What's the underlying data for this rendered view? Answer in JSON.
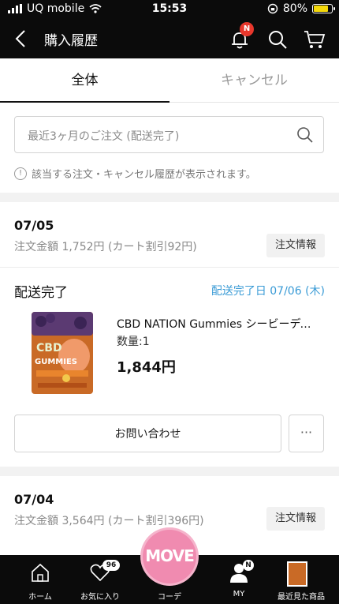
{
  "status_bar": {
    "carrier": "UQ mobile",
    "time": "15:53",
    "battery": "80%",
    "battery_level": 0.8
  },
  "header": {
    "title": "購入履歴",
    "notification_badge": "N"
  },
  "tabs": [
    {
      "label": "全体",
      "active": true
    },
    {
      "label": "キャンセル",
      "active": false
    }
  ],
  "search": {
    "placeholder": "最近3ヶ月のご注文 (配送完了)"
  },
  "notice": "該当する注文・キャンセル履歴が表示されます。",
  "orders": [
    {
      "date": "07/05",
      "amount": "注文金額 1,752円 (カート割引92円)",
      "order_info_label": "注文情報",
      "status": "配送完了",
      "delivery_date": "配送完了日 07/06 (木)",
      "product": {
        "name": "CBD NATION Gummies シービーディーネイション グミ",
        "quantity": "数量:1",
        "price": "1,844円"
      },
      "contact_label": "お問い合わせ",
      "more_label": "···"
    },
    {
      "date": "07/04",
      "amount": "注文金額 3,564円 (カート割引396円)",
      "order_info_label": "注文情報"
    }
  ],
  "tabbar": {
    "items": [
      {
        "label": "ホーム"
      },
      {
        "label": "お気に入り",
        "badge": "96"
      },
      {
        "label": "コーデ"
      },
      {
        "label": "MY",
        "badge": "N"
      },
      {
        "label": "最近見た商品"
      }
    ],
    "move_label": "MOVE"
  }
}
